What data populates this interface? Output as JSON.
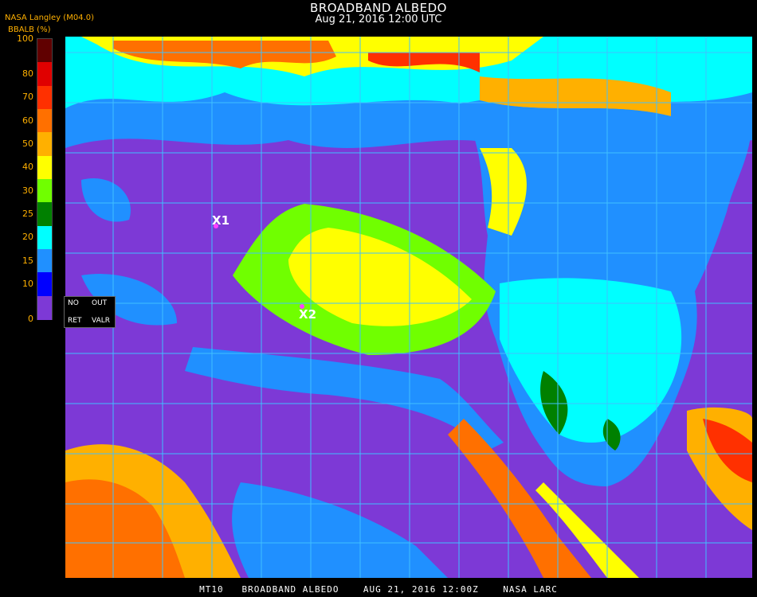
{
  "header": {
    "title": "BROADBAND ALBEDO",
    "subtitle": "Aug 21, 2016 12:00 UTC",
    "org": "NASA Langley (M04.0)"
  },
  "legend": {
    "unit": "BBALB (%)",
    "ticks": [
      "100",
      "80",
      "70",
      "60",
      "50",
      "40",
      "30",
      "25",
      "20",
      "15",
      "10",
      "0"
    ],
    "colors": [
      "#600000",
      "#e00000",
      "#ff3000",
      "#ff7000",
      "#ffb000",
      "#ffff00",
      "#70ff00",
      "#008000",
      "#00ffff",
      "#2090ff",
      "#0000ff",
      "#7d39d6"
    ]
  },
  "menu": {
    "no": "NO",
    "out": "OUT",
    "ret": "RET",
    "valr": "VALR"
  },
  "markers": [
    {
      "label": "X1"
    },
    {
      "label": "X2"
    }
  ],
  "footer": "MT10   BROADBAND ALBEDO    AUG 21, 2016 12:00Z    NASA LARC"
}
